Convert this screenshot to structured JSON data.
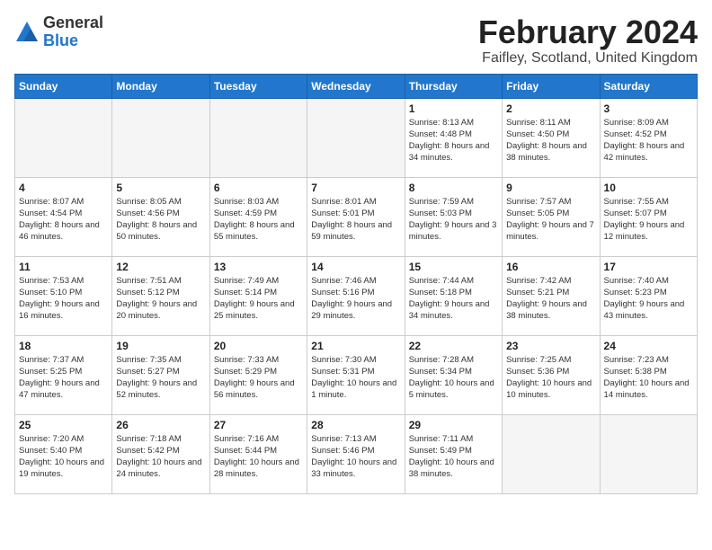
{
  "header": {
    "logo_general": "General",
    "logo_blue": "Blue",
    "title": "February 2024",
    "subtitle": "Faifley, Scotland, United Kingdom"
  },
  "days_of_week": [
    "Sunday",
    "Monday",
    "Tuesday",
    "Wednesday",
    "Thursday",
    "Friday",
    "Saturday"
  ],
  "weeks": [
    [
      {
        "day": "",
        "info": ""
      },
      {
        "day": "",
        "info": ""
      },
      {
        "day": "",
        "info": ""
      },
      {
        "day": "",
        "info": ""
      },
      {
        "day": "1",
        "info": "Sunrise: 8:13 AM\nSunset: 4:48 PM\nDaylight: 8 hours\nand 34 minutes."
      },
      {
        "day": "2",
        "info": "Sunrise: 8:11 AM\nSunset: 4:50 PM\nDaylight: 8 hours\nand 38 minutes."
      },
      {
        "day": "3",
        "info": "Sunrise: 8:09 AM\nSunset: 4:52 PM\nDaylight: 8 hours\nand 42 minutes."
      }
    ],
    [
      {
        "day": "4",
        "info": "Sunrise: 8:07 AM\nSunset: 4:54 PM\nDaylight: 8 hours\nand 46 minutes."
      },
      {
        "day": "5",
        "info": "Sunrise: 8:05 AM\nSunset: 4:56 PM\nDaylight: 8 hours\nand 50 minutes."
      },
      {
        "day": "6",
        "info": "Sunrise: 8:03 AM\nSunset: 4:59 PM\nDaylight: 8 hours\nand 55 minutes."
      },
      {
        "day": "7",
        "info": "Sunrise: 8:01 AM\nSunset: 5:01 PM\nDaylight: 8 hours\nand 59 minutes."
      },
      {
        "day": "8",
        "info": "Sunrise: 7:59 AM\nSunset: 5:03 PM\nDaylight: 9 hours\nand 3 minutes."
      },
      {
        "day": "9",
        "info": "Sunrise: 7:57 AM\nSunset: 5:05 PM\nDaylight: 9 hours\nand 7 minutes."
      },
      {
        "day": "10",
        "info": "Sunrise: 7:55 AM\nSunset: 5:07 PM\nDaylight: 9 hours\nand 12 minutes."
      }
    ],
    [
      {
        "day": "11",
        "info": "Sunrise: 7:53 AM\nSunset: 5:10 PM\nDaylight: 9 hours\nand 16 minutes."
      },
      {
        "day": "12",
        "info": "Sunrise: 7:51 AM\nSunset: 5:12 PM\nDaylight: 9 hours\nand 20 minutes."
      },
      {
        "day": "13",
        "info": "Sunrise: 7:49 AM\nSunset: 5:14 PM\nDaylight: 9 hours\nand 25 minutes."
      },
      {
        "day": "14",
        "info": "Sunrise: 7:46 AM\nSunset: 5:16 PM\nDaylight: 9 hours\nand 29 minutes."
      },
      {
        "day": "15",
        "info": "Sunrise: 7:44 AM\nSunset: 5:18 PM\nDaylight: 9 hours\nand 34 minutes."
      },
      {
        "day": "16",
        "info": "Sunrise: 7:42 AM\nSunset: 5:21 PM\nDaylight: 9 hours\nand 38 minutes."
      },
      {
        "day": "17",
        "info": "Sunrise: 7:40 AM\nSunset: 5:23 PM\nDaylight: 9 hours\nand 43 minutes."
      }
    ],
    [
      {
        "day": "18",
        "info": "Sunrise: 7:37 AM\nSunset: 5:25 PM\nDaylight: 9 hours\nand 47 minutes."
      },
      {
        "day": "19",
        "info": "Sunrise: 7:35 AM\nSunset: 5:27 PM\nDaylight: 9 hours\nand 52 minutes."
      },
      {
        "day": "20",
        "info": "Sunrise: 7:33 AM\nSunset: 5:29 PM\nDaylight: 9 hours\nand 56 minutes."
      },
      {
        "day": "21",
        "info": "Sunrise: 7:30 AM\nSunset: 5:31 PM\nDaylight: 10 hours\nand 1 minute."
      },
      {
        "day": "22",
        "info": "Sunrise: 7:28 AM\nSunset: 5:34 PM\nDaylight: 10 hours\nand 5 minutes."
      },
      {
        "day": "23",
        "info": "Sunrise: 7:25 AM\nSunset: 5:36 PM\nDaylight: 10 hours\nand 10 minutes."
      },
      {
        "day": "24",
        "info": "Sunrise: 7:23 AM\nSunset: 5:38 PM\nDaylight: 10 hours\nand 14 minutes."
      }
    ],
    [
      {
        "day": "25",
        "info": "Sunrise: 7:20 AM\nSunset: 5:40 PM\nDaylight: 10 hours\nand 19 minutes."
      },
      {
        "day": "26",
        "info": "Sunrise: 7:18 AM\nSunset: 5:42 PM\nDaylight: 10 hours\nand 24 minutes."
      },
      {
        "day": "27",
        "info": "Sunrise: 7:16 AM\nSunset: 5:44 PM\nDaylight: 10 hours\nand 28 minutes."
      },
      {
        "day": "28",
        "info": "Sunrise: 7:13 AM\nSunset: 5:46 PM\nDaylight: 10 hours\nand 33 minutes."
      },
      {
        "day": "29",
        "info": "Sunrise: 7:11 AM\nSunset: 5:49 PM\nDaylight: 10 hours\nand 38 minutes."
      },
      {
        "day": "",
        "info": ""
      },
      {
        "day": "",
        "info": ""
      }
    ]
  ]
}
